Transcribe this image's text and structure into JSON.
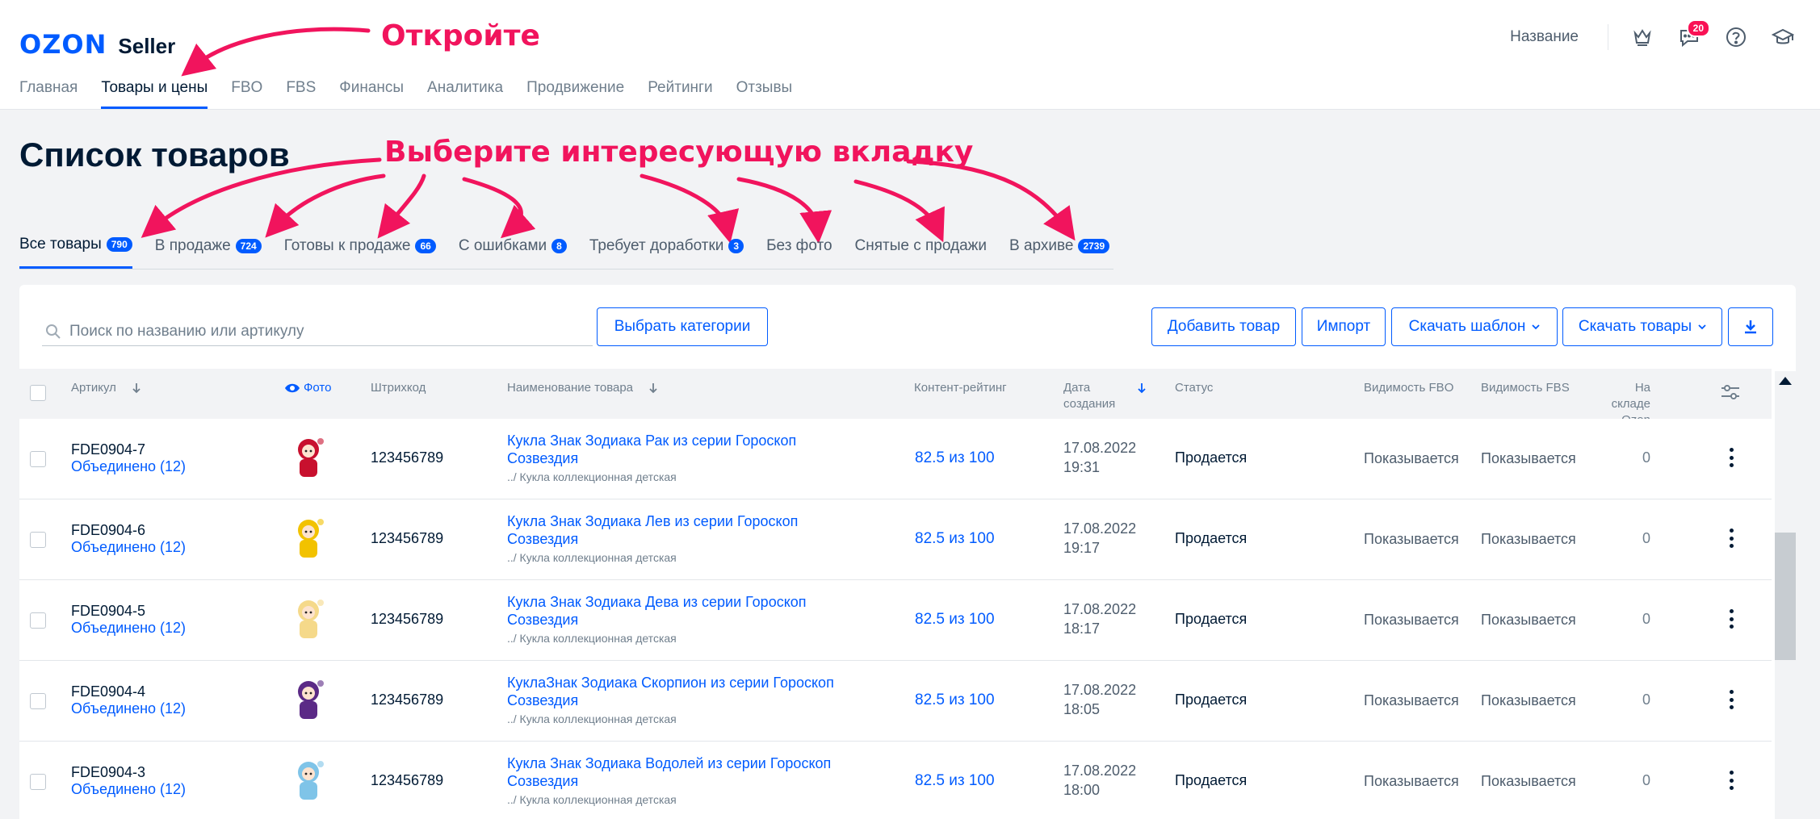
{
  "header": {
    "logo_brand": "OZON",
    "logo_product": "Seller",
    "nav": [
      {
        "label": "Главная"
      },
      {
        "label": "Товары и цены"
      },
      {
        "label": "FBO"
      },
      {
        "label": "FBS"
      },
      {
        "label": "Финансы"
      },
      {
        "label": "Аналитика"
      },
      {
        "label": "Продвижение"
      },
      {
        "label": "Рейтинги"
      },
      {
        "label": "Отзывы"
      }
    ],
    "company_name": "Название",
    "messages_badge": "20",
    "icons": [
      "crown-icon",
      "chat-icon",
      "help-icon",
      "graduation-cap-icon"
    ]
  },
  "annotations": {
    "open": "Откройте",
    "choose_tab": "Выберите интересующую вкладку"
  },
  "page": {
    "title": "Список товаров"
  },
  "tabs": [
    {
      "label": "Все товары",
      "count": "790"
    },
    {
      "label": "В продаже",
      "count": "724"
    },
    {
      "label": "Готовы к продаже",
      "count": "66"
    },
    {
      "label": "С ошибками",
      "count": "8"
    },
    {
      "label": "Требует доработки",
      "count": "3"
    },
    {
      "label": "Без фото",
      "count": ""
    },
    {
      "label": "Снятые с продажи",
      "count": ""
    },
    {
      "label": "В архиве",
      "count": "2739"
    }
  ],
  "toolbar": {
    "search_placeholder": "Поиск по названию или артикулу",
    "choose_categories": "Выбрать категории",
    "add_product": "Добавить товар",
    "import": "Импорт",
    "download_template": "Скачать шаблон",
    "download_products": "Скачать товары"
  },
  "table": {
    "columns": {
      "sku": "Артикул",
      "photo": "Фото",
      "barcode": "Штрихкод",
      "name": "Наименование товара",
      "content_rating": "Контент-рейтинг",
      "created_line1": "Дата",
      "created_line2": "создания",
      "status": "Статус",
      "fbo": "Видимость FBO",
      "fbs": "Видимость FBS",
      "stock_line1": "На складе",
      "stock_line2": "Ozon"
    },
    "rows": [
      {
        "sku": "FDE0904-7",
        "merged": "Объединено (12)",
        "barcode": "123456789",
        "name": "Кукла Знак Зодиака Рак из серии Гороскоп Созвездия",
        "category": "../ Кукла коллекционная детская",
        "rating": "82.5 из 100",
        "date": "17.08.2022",
        "time": "19:31",
        "status": "Продается",
        "fbo": "Показывается",
        "fbs": "Показывается",
        "stock": "0",
        "doll_color": "#c8102e"
      },
      {
        "sku": "FDE0904-6",
        "merged": "Объединено (12)",
        "barcode": "123456789",
        "name": "Кукла Знак Зодиака Лев из серии Гороскоп Созвездия",
        "category": "../ Кукла коллекционная детская",
        "rating": "82.5 из 100",
        "date": "17.08.2022",
        "time": "19:17",
        "status": "Продается",
        "fbo": "Показывается",
        "fbs": "Показывается",
        "stock": "0",
        "doll_color": "#f2c200"
      },
      {
        "sku": "FDE0904-5",
        "merged": "Объединено (12)",
        "barcode": "123456789",
        "name": "Кукла Знак Зодиака Дева из серии Гороскоп Созвездия",
        "category": "../ Кукла коллекционная детская",
        "rating": "82.5 из 100",
        "date": "17.08.2022",
        "time": "18:17",
        "status": "Продается",
        "fbo": "Показывается",
        "fbs": "Показывается",
        "stock": "0",
        "doll_color": "#f5d98a"
      },
      {
        "sku": "FDE0904-4",
        "merged": "Объединено (12)",
        "barcode": "123456789",
        "name": "КуклаЗнак Зодиака Скорпион из серии Гороскоп Созвездия",
        "category": "../ Кукла коллекционная детская",
        "rating": "82.5 из 100",
        "date": "17.08.2022",
        "time": "18:05",
        "status": "Продается",
        "fbo": "Показывается",
        "fbs": "Показывается",
        "stock": "0",
        "doll_color": "#5b2a86"
      },
      {
        "sku": "FDE0904-3",
        "merged": "Объединено (12)",
        "barcode": "123456789",
        "name": "Кукла Знак Зодиака Водолей из серии Гороскоп Созвездия",
        "category": "../ Кукла коллекционная детская",
        "rating": "82.5 из 100",
        "date": "17.08.2022",
        "time": "18:00",
        "status": "Продается",
        "fbo": "Показывается",
        "fbs": "Показывается",
        "stock": "0",
        "doll_color": "#7fc4e8"
      }
    ]
  },
  "colors": {
    "brand": "#005bff",
    "annotation": "#f1145d",
    "badge_red": "#f91155"
  }
}
